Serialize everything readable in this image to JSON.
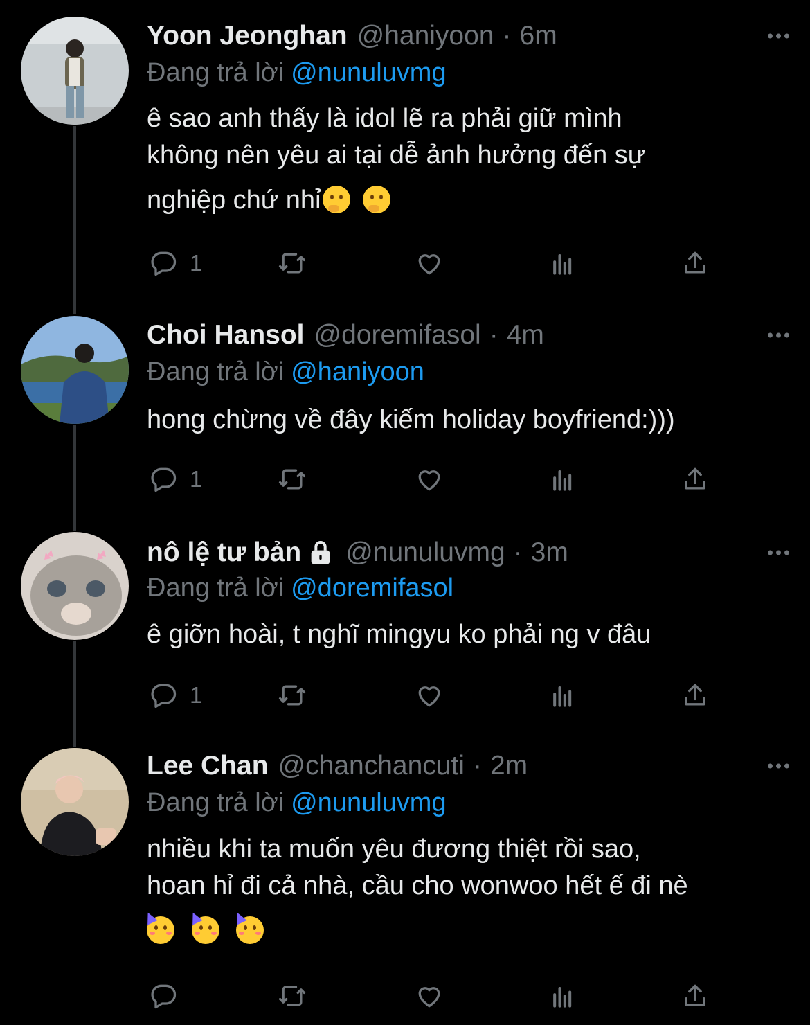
{
  "reply_prefix": "Đang trả lời",
  "tweets": [
    {
      "name": "Yoon Jeonghan",
      "handle": "@haniyoon",
      "time": "6m",
      "reply_to": "@nunuluvmg",
      "text_lines": [
        "ê sao anh thấy là idol lẽ ra phải giữ mình",
        "không nên yêu ai tại dễ ảnh hưởng đến sự",
        "nghiệp chứ nhỉ"
      ],
      "reply_count": "1",
      "avatar_colors": {
        "bg": "#c9cfd2",
        "figure": "#5e5a4d"
      }
    },
    {
      "name": "Choi Hansol",
      "handle": "@doremifasol",
      "time": "4m",
      "reply_to": "@haniyoon",
      "text_lines": [
        "hong chừng về đây kiếm holiday boyfriend:)))"
      ],
      "reply_count": "1",
      "avatar_colors": {
        "bg": "#8fb6e0",
        "figure": "#2d4f86"
      }
    },
    {
      "name": "nô lệ tư bản",
      "handle": "@nunuluvmg",
      "time": "3m",
      "reply_to": "@doremifasol",
      "text_lines": [
        "ê giỡn hoài, t nghĩ mingyu ko phải ng v đâu"
      ],
      "reply_count": "1",
      "avatar_colors": {
        "bg": "#d9d2cc",
        "figure": "#8a8580"
      }
    },
    {
      "name": "Lee Chan",
      "handle": "@chanchancuti",
      "time": "2m",
      "reply_to": "@nunuluvmg",
      "text_lines": [
        "nhiều khi ta muốn yêu đương thiệt rồi sao,",
        "hoan hỉ đi cả nhà, cầu cho wonwoo hết ế đi nè"
      ],
      "reply_count": "",
      "avatar_colors": {
        "bg": "#cfbfa3",
        "figure": "#1c1c20"
      }
    }
  ],
  "colors": {
    "background": "#000000",
    "text": "#e7e9ea",
    "secondary": "#71767b",
    "link": "#1d9bf0",
    "thread_line": "#333639"
  },
  "icons": [
    "reply-icon",
    "retweet-icon",
    "like-icon",
    "views-icon",
    "share-icon",
    "more-icon",
    "lock-icon"
  ]
}
